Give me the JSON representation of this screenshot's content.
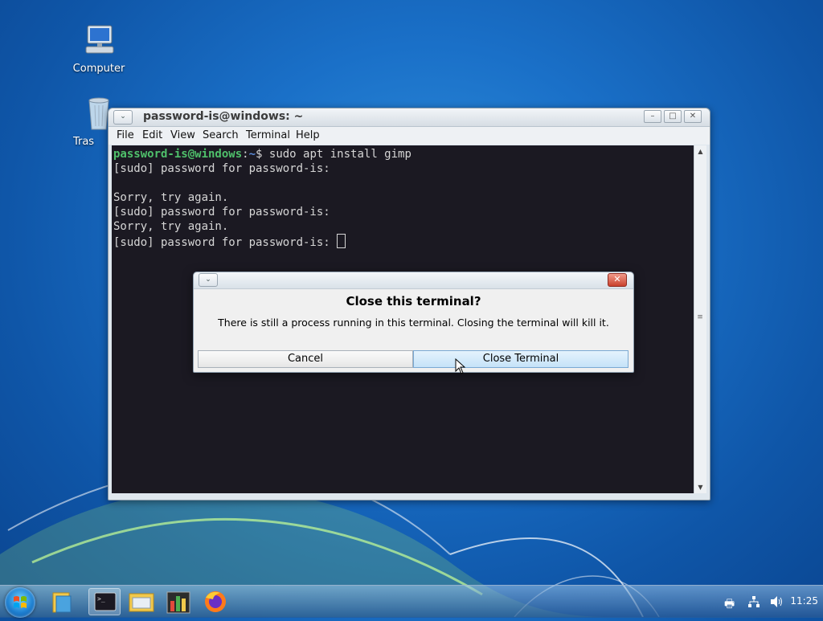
{
  "desktop": {
    "icons": [
      {
        "label": "Computer"
      },
      {
        "label": "Tras"
      }
    ]
  },
  "terminal_window": {
    "title": "password-is@windows: ~",
    "menu": [
      "File",
      "Edit",
      "View",
      "Search",
      "Terminal",
      "Help"
    ],
    "prompt_user": "password-is@windows",
    "prompt_sep": ":",
    "prompt_path": "~",
    "command": "$ sudo apt install gimp",
    "lines": [
      "[sudo] password for password-is:",
      "",
      "Sorry, try again.",
      "[sudo] password for password-is:",
      "Sorry, try again.",
      "[sudo] password for password-is: "
    ]
  },
  "dialog": {
    "heading": "Close this terminal?",
    "message": "There is still a process running in this terminal. Closing the terminal will kill it.",
    "cancel_label": "Cancel",
    "confirm_label": "Close Terminal"
  },
  "taskbar": {
    "clock": "11:25",
    "apps": [
      "start-orb",
      "file-manager",
      "terminal",
      "files",
      "task-manager",
      "firefox"
    ]
  }
}
